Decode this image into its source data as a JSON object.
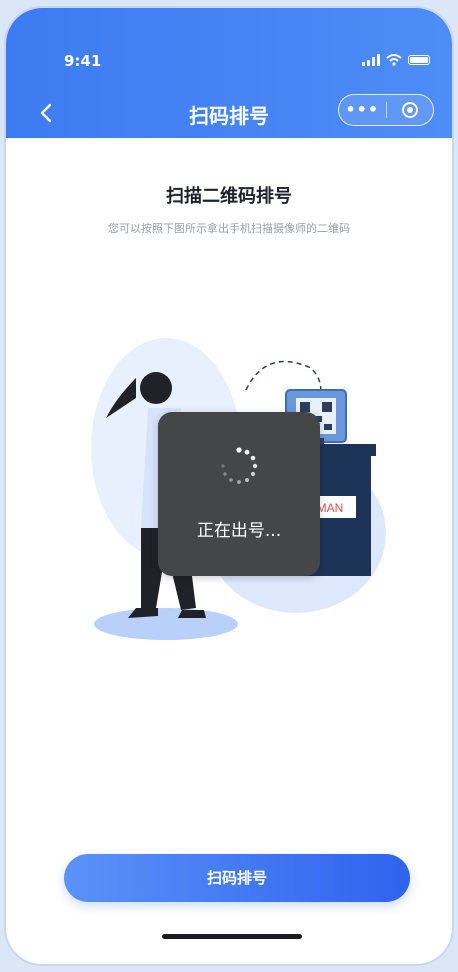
{
  "status_bar": {
    "time": "9:41"
  },
  "nav": {
    "title": "扫码排号",
    "back_icon": "chevron-left-icon",
    "more_label": "•••"
  },
  "content": {
    "title": "扫描二维码排号",
    "subtitle": "您可以按照下图所示拿出手机扫描摄像师的二维码",
    "sign_text": "MAN"
  },
  "toast": {
    "text": "正在出号..."
  },
  "cta": {
    "label": "扫码排号"
  },
  "colors": {
    "primary": "#3d7bf2",
    "toast_bg": "#444648",
    "accent_dark": "#1e3358"
  }
}
